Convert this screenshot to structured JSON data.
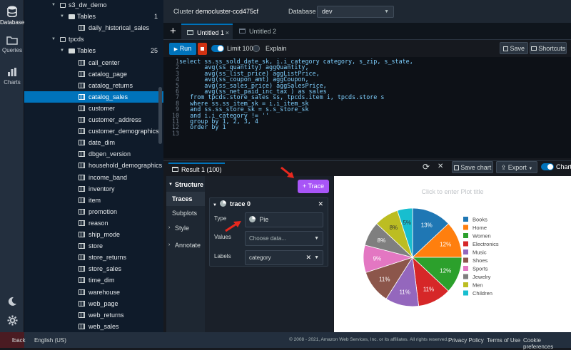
{
  "rail": {
    "database_label": "Database",
    "queries_label": "Queries",
    "charts_label": "Charts"
  },
  "tree": {
    "items": [
      {
        "label": "s3_dw_demo",
        "count": ""
      },
      {
        "label": "Tables",
        "count": "1"
      },
      {
        "label": "daily_historical_sales",
        "count": ""
      },
      {
        "label": "tpcds",
        "count": ""
      },
      {
        "label": "Tables",
        "count": "25"
      },
      {
        "label": "call_center",
        "count": ""
      },
      {
        "label": "catalog_page",
        "count": ""
      },
      {
        "label": "catalog_returns",
        "count": ""
      },
      {
        "label": "catalog_sales",
        "count": ""
      },
      {
        "label": "customer",
        "count": ""
      },
      {
        "label": "customer_address",
        "count": ""
      },
      {
        "label": "customer_demographics",
        "count": ""
      },
      {
        "label": "date_dim",
        "count": ""
      },
      {
        "label": "dbgen_version",
        "count": ""
      },
      {
        "label": "household_demographics",
        "count": ""
      },
      {
        "label": "income_band",
        "count": ""
      },
      {
        "label": "inventory",
        "count": ""
      },
      {
        "label": "item",
        "count": ""
      },
      {
        "label": "promotion",
        "count": ""
      },
      {
        "label": "reason",
        "count": ""
      },
      {
        "label": "ship_mode",
        "count": ""
      },
      {
        "label": "store",
        "count": ""
      },
      {
        "label": "store_returns",
        "count": ""
      },
      {
        "label": "store_sales",
        "count": ""
      },
      {
        "label": "time_dim",
        "count": ""
      },
      {
        "label": "warehouse",
        "count": ""
      },
      {
        "label": "web_page",
        "count": ""
      },
      {
        "label": "web_returns",
        "count": ""
      },
      {
        "label": "web_sales",
        "count": ""
      }
    ]
  },
  "header": {
    "cluster_label": "Cluster",
    "cluster_value": "democluster-ccd475cf",
    "database_label": "Database",
    "database_value": "dev"
  },
  "tabs": {
    "tab1": "Untitled 1",
    "tab2": "Untitled 2"
  },
  "toolbar": {
    "run": "Run",
    "limit": "Limit 100",
    "explain": "Explain",
    "save": "Save",
    "shortcuts": "Shortcuts"
  },
  "editor": {
    "lines": [
      "select ss.ss_sold_date_sk, i.i_category category, s_zip, s_state,",
      "       avg(ss_quantity) aggQuantity,",
      "       avg(ss_list_price) aggListPrice,",
      "       avg(ss_coupon_amt) aggCoupon,",
      "       avg(ss_sales_price) aggSalesPrice,",
      "       avg(ss_net_paid_inc_tax ) as sales",
      "   from tpcds.store_sales ss, tpcds.item i, tpcds.store s",
      "   where ss.ss_item_sk = i.i_item_sk",
      "   and ss.ss_store_sk = s.s_store_sk",
      "   and i.i_category != ''",
      "   group by 1, 2, 3, 4",
      "   order by 1",
      ""
    ]
  },
  "result": {
    "tab_label": "Result 1 (100)",
    "save_chart": "Save chart",
    "export": "Export",
    "chart": "Chart"
  },
  "panel": {
    "structure": "Structure",
    "traces": "Traces",
    "subplots": "Subplots",
    "style": "Style",
    "annotate": "Annotate",
    "trace_button": "+ Trace",
    "trace_name": "trace 0",
    "type_label": "Type",
    "type_value": "Pie",
    "values_label": "Values",
    "values_placeholder": "Choose data...",
    "labels_label": "Labels",
    "labels_value": "category"
  },
  "plot": {
    "title_placeholder": "Click to enter Plot title"
  },
  "chart_data": {
    "type": "pie",
    "title": "",
    "slices": [
      {
        "label": "Books",
        "value": 13,
        "color": "#1f77b4"
      },
      {
        "label": "Home",
        "value": 12,
        "color": "#ff7f0e"
      },
      {
        "label": "Women",
        "value": 12,
        "color": "#2ca02c"
      },
      {
        "label": "Electronics",
        "value": 11,
        "color": "#d62728"
      },
      {
        "label": "Music",
        "value": 11,
        "color": "#9467bd"
      },
      {
        "label": "Shoes",
        "value": 11,
        "color": "#8c564b"
      },
      {
        "label": "Sports",
        "value": 9,
        "color": "#e377c2"
      },
      {
        "label": "Jewelry",
        "value": 8,
        "color": "#7f7f7f"
      },
      {
        "label": "Men",
        "value": 8,
        "color": "#bcbd22"
      },
      {
        "label": "Children",
        "value": 5,
        "color": "#17becf"
      }
    ],
    "legend": "right"
  },
  "footer": {
    "feedback": "lback",
    "language": "English (US)",
    "copyright": "© 2008 - 2021, Amazon Web Services, Inc. or its affiliates. All rights reserved.",
    "privacy": "Privacy Policy",
    "terms": "Terms of Use",
    "cookies": "Cookie preferences"
  }
}
